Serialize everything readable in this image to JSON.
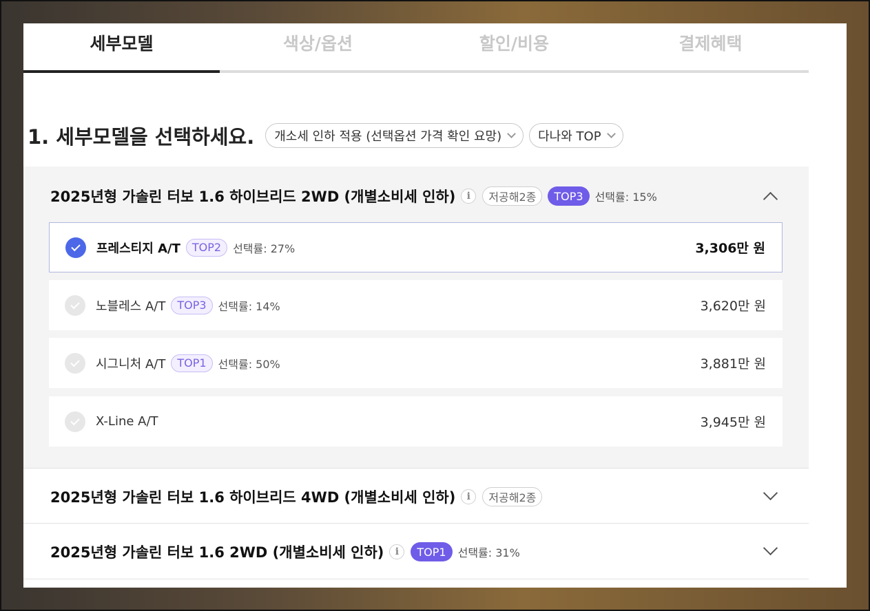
{
  "tabs": [
    {
      "label": "세부모델",
      "active": true
    },
    {
      "label": "색상/옵션",
      "active": false
    },
    {
      "label": "할인/비용",
      "active": false
    },
    {
      "label": "결제혜택",
      "active": false
    }
  ],
  "section": {
    "title": "1. 세부모델을 선택하세요.",
    "filters": [
      {
        "label": "개소세 인하 적용 (선택옵션 가격 확인 요망)"
      },
      {
        "label": "다나와 TOP"
      }
    ]
  },
  "groups": [
    {
      "title": "2025년형 가솔린 터보 1.6 하이브리드 2WD (개별소비세 인하)",
      "info_icon": "i",
      "badge": "저공해2종",
      "top": "TOP3",
      "rate": "선택률: 15%",
      "expanded": true,
      "options": [
        {
          "name": "프레스티지 A/T",
          "top": "TOP2",
          "rate": "선택률: 27%",
          "price": "3,306만 원",
          "selected": true
        },
        {
          "name": "노블레스 A/T",
          "top": "TOP3",
          "rate": "선택률: 14%",
          "price": "3,620만 원",
          "selected": false
        },
        {
          "name": "시그니처 A/T",
          "top": "TOP1",
          "rate": "선택률: 50%",
          "price": "3,881만 원",
          "selected": false
        },
        {
          "name": "X-Line A/T",
          "top": "",
          "rate": "",
          "price": "3,945만 원",
          "selected": false
        }
      ]
    },
    {
      "title": "2025년형 가솔린 터보 1.6 하이브리드 4WD (개별소비세 인하)",
      "info_icon": "i",
      "badge": "저공해2종",
      "expanded": false
    },
    {
      "title": "2025년형 가솔린 터보 1.6 2WD (개별소비세 인하)",
      "info_icon": "i",
      "top": "TOP1",
      "rate": "선택률: 31%",
      "expanded": false
    }
  ],
  "colors": {
    "accent_purple": "#6f5ce8",
    "check_blue": "#4c68e8"
  },
  "icons": [
    "check-circle-icon",
    "info-icon",
    "chevron-up-icon",
    "chevron-down-icon"
  ]
}
